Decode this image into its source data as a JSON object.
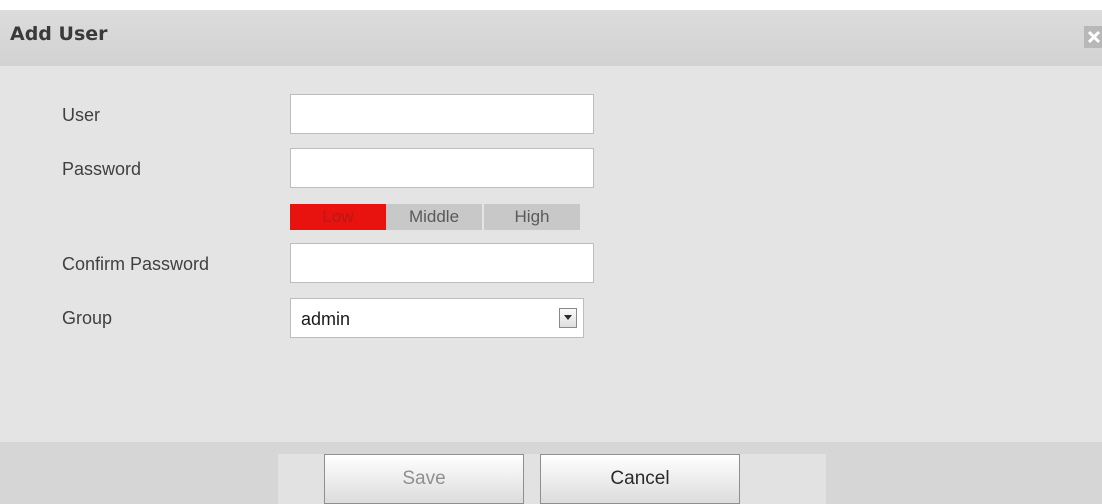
{
  "dialog": {
    "title": "Add User",
    "close_icon": "close-icon"
  },
  "form": {
    "user": {
      "label": "User",
      "value": ""
    },
    "password": {
      "label": "Password",
      "value": ""
    },
    "strength": {
      "levels": [
        "Low",
        "Middle",
        "High"
      ],
      "active": "Low",
      "active_color": "#e8120f"
    },
    "confirm_password": {
      "label": "Confirm Password",
      "value": ""
    },
    "group": {
      "label": "Group",
      "value": "admin",
      "arrow_icon": "chevron-down-icon"
    }
  },
  "buttons": {
    "save_label": "Save",
    "cancel_label": "Cancel"
  }
}
